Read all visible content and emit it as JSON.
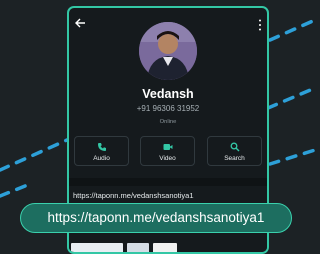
{
  "contact": {
    "name": "Vedansh",
    "phone": "+91 96306 31952",
    "status": "Online",
    "link": "https://taponn.me/vedanshsanotiya1"
  },
  "actions": [
    {
      "label": "Audio",
      "icon": "phone-icon"
    },
    {
      "label": "Video",
      "icon": "video-icon"
    },
    {
      "label": "Search",
      "icon": "search-icon"
    }
  ],
  "overlay": {
    "url": "https://taponn.me/vedanshsanotiya1"
  },
  "colors": {
    "accent": "#33c7a5",
    "pill_bg": "#1d6e60",
    "background": "#1c2225",
    "panel": "#151a1d"
  }
}
